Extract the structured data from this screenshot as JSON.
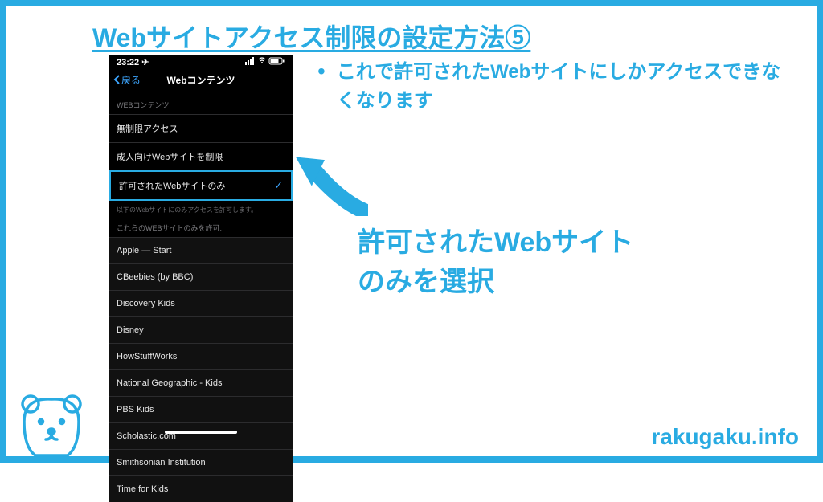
{
  "title": "Webサイトアクセス制限の設定方法⑤",
  "bullet": "これで許可されたWebサイトにしかアクセスできなくなります",
  "callout": "許可されたWebサイト\nのみを選択",
  "watermark": "rakugaku.info",
  "phone": {
    "time": "23:22",
    "back": "戻る",
    "navTitle": "Webコンテンツ",
    "section1": "WEBコンテンツ",
    "options": [
      "無制限アクセス",
      "成人向けWebサイトを制限",
      "許可されたWebサイトのみ"
    ],
    "footnote": "以下のWebサイトにのみアクセスを許可します。",
    "section2": "これらのWEBサイトのみを許可:",
    "sites": [
      "Apple — Start",
      "CBeebies (by BBC)",
      "Discovery Kids",
      "Disney",
      "HowStuffWorks",
      "National Geographic - Kids",
      "PBS Kids",
      "Scholastic.com",
      "Smithsonian Institution",
      "Time for Kids"
    ]
  }
}
